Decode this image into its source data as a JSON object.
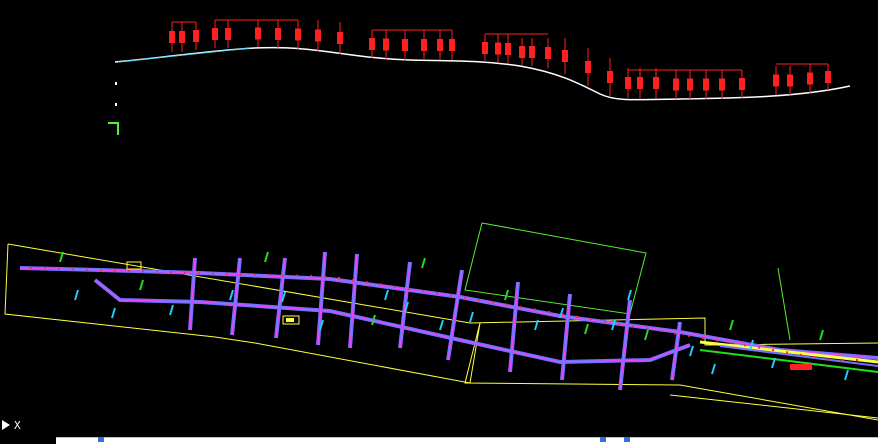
{
  "viewport": {
    "background": "#000000",
    "colors": {
      "profile_line": "#ffffff",
      "profile_markers": "#ff2020",
      "profile_start": "#55ddff",
      "road_edge": "#7070ff",
      "road_center": "#ff40ff",
      "boundary": "#ffff40",
      "outline_green": "#55ee33",
      "cyan_labels": "#22ccff",
      "hatch_green": "#22dd22"
    }
  },
  "ucs_icon": {
    "x_label": "X",
    "arrow_icon": "triangle-icon"
  },
  "status_bar": {
    "background": "#ffffff",
    "icons": [
      "grid-icon",
      "snap-icon",
      "ortho-icon"
    ]
  }
}
